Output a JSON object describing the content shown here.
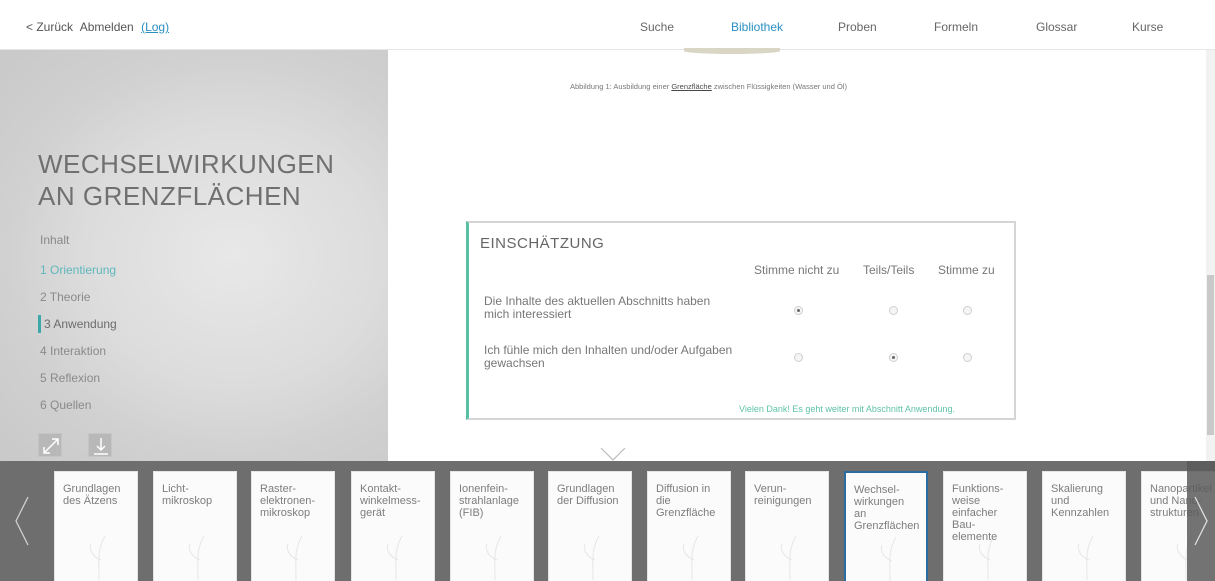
{
  "topbar": {
    "back": "< Zurück",
    "logout": "Abmelden",
    "log": "(Log)",
    "nav": [
      "Suche",
      "Bibliothek",
      "Proben",
      "Formeln",
      "Glossar",
      "Kurse"
    ],
    "active_nav": "Bibliothek"
  },
  "sidebar": {
    "title_line1": "WECHSELWIRKUNGEN",
    "title_line2": "AN GRENZFLÄCHEN",
    "inhalt": "Inhalt",
    "toc": [
      "1 Orientierung",
      "2 Theorie",
      "3 Anwendung",
      "4 Interaktion",
      "5 Reflexion",
      "6 Quellen"
    ]
  },
  "content": {
    "caption_pre": "Abbildung 1: Ausbildung einer ",
    "caption_link": "Grenzfläche",
    "caption_post": " zwischen Flüssigkeiten (Wasser und Öl)"
  },
  "evaluation": {
    "title": "EINSCHÄTZUNG",
    "columns": [
      "Stimme nicht zu",
      "Teils/Teils",
      "Stimme zu"
    ],
    "questions": [
      {
        "text": "Die Inhalte des aktuellen Abschnitts haben mich interessiert",
        "selected": 0
      },
      {
        "text": "Ich fühle mich den Inhalten und/oder Aufgaben gewachsen",
        "selected": 1
      }
    ],
    "thanks": "Vielen Dank! Es geht weiter mit Abschnitt Anwendung."
  },
  "courses": [
    "Grundlagen\ndes Ätzens",
    "Licht-\nmikroskop",
    "Raster-\nelektronen-\nmikroskop",
    "Kontakt-\nwinkelmess-\ngerät",
    "Ionenfein-\nstrahlanlage\n(FIB)",
    "Grundlagen\nder Diffusion",
    "Diffusion in\ndie\nGrenzfläche",
    "Verun-\nreinigungen",
    "Wechsel-\nwirkungen\nan\nGrenzflächen",
    "Funktions-\nweise\neinfacher\nBau-\nelemente",
    "Skalierung\nund\nKennzahlen",
    "Nanopartikel\nund Nano-\nstrukturen"
  ],
  "selected_course": 8,
  "colors": {
    "accent": "#2a8fc1",
    "teal": "#58c0a4",
    "selected_border": "#2a6ca0"
  }
}
